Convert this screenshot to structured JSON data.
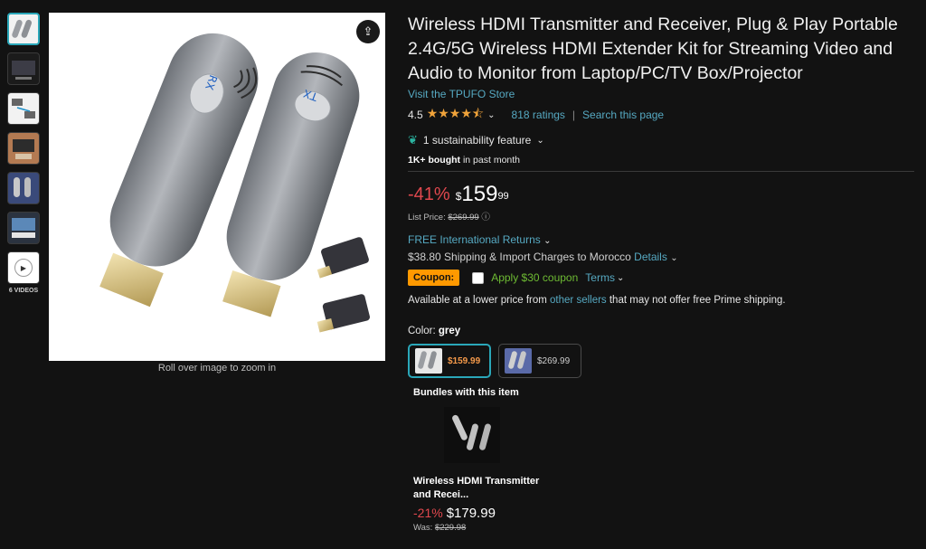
{
  "gallery": {
    "videos_label": "6 VIDEOS",
    "zoom_caption": "Roll over image to zoom in",
    "product_labels": {
      "left": "RX",
      "right": "TX"
    }
  },
  "product": {
    "title": "Wireless HDMI Transmitter and Receiver, Plug & Play Portable 2.4G/5G Wireless HDMI Extender Kit for Streaming Video and Audio to Monitor from Laptop/PC/TV Box/Projector",
    "store_link": "Visit the TPUFO Store",
    "rating_value": "4.5",
    "stars_glyph": "★★★★⯪",
    "ratings_count": "818 ratings",
    "search_link": "Search this page",
    "sustainability": "1 sustainability feature",
    "bought_bold": "1K+ bought",
    "bought_rest": " in past month",
    "discount": "-41%",
    "currency": "$",
    "price_whole": "159",
    "price_fraction": "99",
    "list_price_label": "List Price:",
    "list_price": "$269.99",
    "returns_link": "FREE International Returns",
    "shipping_text": "$38.80 Shipping & Import Charges to Morocco",
    "details_link": "Details",
    "coupon_tag": "Coupon:",
    "coupon_text": "Apply $30 coupon",
    "terms_link": "Terms",
    "avail_before": "Available at a lower price from ",
    "avail_link": "other sellers",
    "avail_after": " that may not offer free Prime shipping.",
    "color_label": "Color: ",
    "color_value": "grey",
    "swatches": [
      {
        "price": "$159.99"
      },
      {
        "price": "$269.99"
      }
    ]
  },
  "bundles": {
    "title": "Bundles with this item",
    "item_name": "Wireless HDMI Transmitter and Recei...",
    "discount": "-21%",
    "price": "$179.99",
    "was_label": "Was:",
    "was_price": "$229.98"
  },
  "colors": {
    "accent_link": "#56a9c2",
    "discount_red": "#e0484e",
    "coupon_orange": "#ff9900",
    "coupon_green": "#6ebb33",
    "selected_border": "#2aa7b9"
  }
}
